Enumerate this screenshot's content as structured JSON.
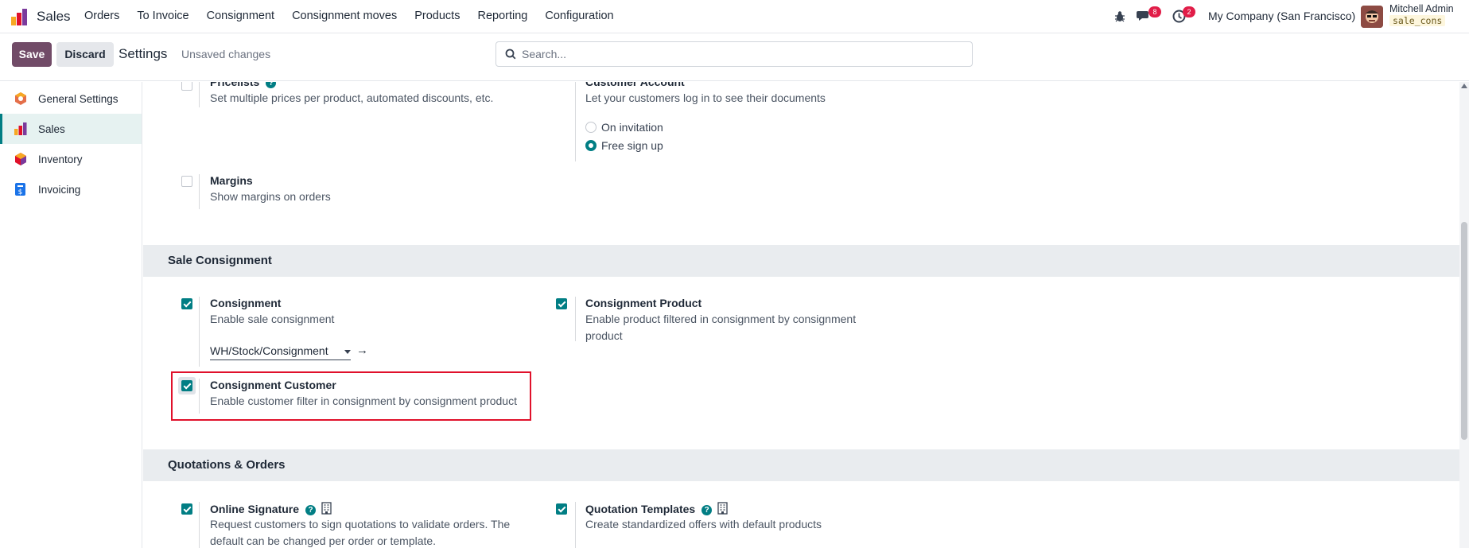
{
  "navbar": {
    "app_name": "Sales",
    "menu": [
      "Orders",
      "To Invoice",
      "Consignment",
      "Consignment moves",
      "Products",
      "Reporting",
      "Configuration"
    ],
    "messages_count": "8",
    "activities_count": "2",
    "company": "My Company (San Francisco)",
    "user_name": "Mitchell Admin",
    "db_name": "sale_cons"
  },
  "control_panel": {
    "save_label": "Save",
    "discard_label": "Discard",
    "title": "Settings",
    "status": "Unsaved changes",
    "search_placeholder": "Search..."
  },
  "sidebar": {
    "items": [
      {
        "label": "General Settings",
        "icon": "general-settings-icon"
      },
      {
        "label": "Sales",
        "icon": "sales-app-icon",
        "active": true
      },
      {
        "label": "Inventory",
        "icon": "inventory-app-icon"
      },
      {
        "label": "Invoicing",
        "icon": "invoicing-app-icon"
      }
    ]
  },
  "settings": {
    "pricelists": {
      "title": "Pricelists",
      "desc": "Set multiple prices per product, automated discounts, etc.",
      "checked": false
    },
    "customer_account": {
      "title": "Customer Account",
      "desc": "Let your customers log in to see their documents",
      "options": [
        "On invitation",
        "Free sign up"
      ],
      "selected": "Free sign up"
    },
    "margins": {
      "title": "Margins",
      "desc": "Show margins on orders",
      "checked": false
    },
    "sale_consignment_header": "Sale Consignment",
    "consignment": {
      "title": "Consignment",
      "desc": "Enable sale consignment",
      "checked": true,
      "location": "WH/Stock/Consignment"
    },
    "consignment_product": {
      "title": "Consignment Product",
      "desc": "Enable product filtered in consignment by consignment product",
      "checked": true
    },
    "consignment_customer": {
      "title": "Consignment Customer",
      "desc": "Enable customer filter in consignment by consignment product",
      "checked": true
    },
    "quotations_header": "Quotations & Orders",
    "online_signature": {
      "title": "Online Signature",
      "desc": "Request customers to sign quotations to validate orders. The default can be changed per order or template.",
      "checked": true
    },
    "quotation_templates": {
      "title": "Quotation Templates",
      "desc": "Create standardized offers with default products",
      "checked": true
    }
  },
  "colors": {
    "brand": "#714b67",
    "accent": "#017e84",
    "highlight": "#e0112b",
    "badge": "#e11d48"
  }
}
